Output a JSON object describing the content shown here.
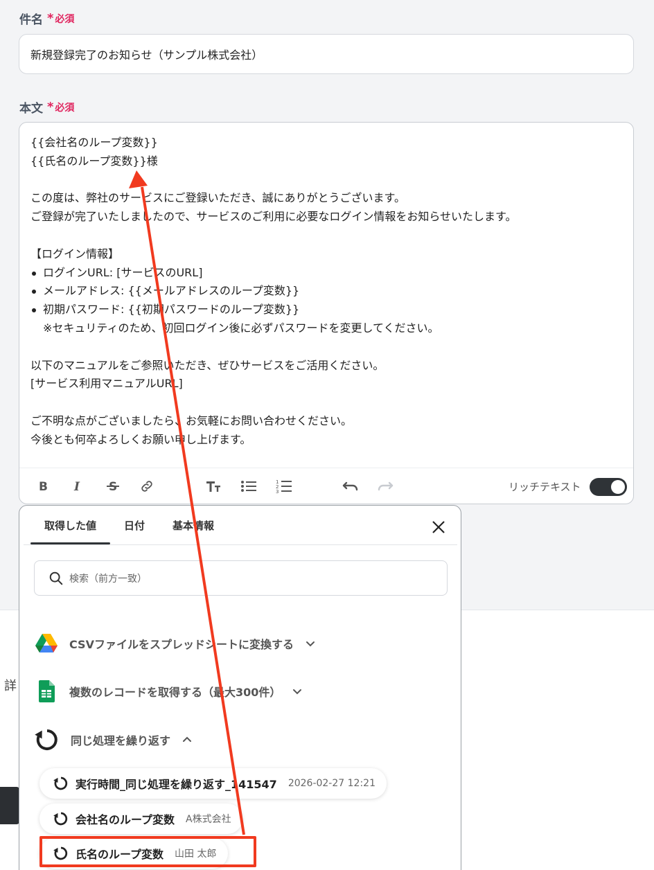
{
  "subject": {
    "label": "件名",
    "required_mark": "*",
    "required_text": "必須",
    "value": "新規登録完了のお知らせ（サンプル株式会社）"
  },
  "body": {
    "label": "本文",
    "required_mark": "*",
    "required_text": "必須",
    "lines": {
      "l1": "{{会社名のループ変数}}",
      "l2": "{{氏名のループ変数}}様",
      "l4": "この度は、弊社のサービスにご登録いただき、誠にありがとうございます。",
      "l5": "ご登録が完了いたしましたので、サービスのご利用に必要なログイン情報をお知らせいたします。",
      "l7": "【ログイン情報】",
      "li1": "ログインURL: [サービスのURL]",
      "li2": "メールアドレス: {{メールアドレスのループ変数}}",
      "li3": "初期パスワード: {{初期パスワードのループ変数}}",
      "note": "※セキュリティのため、初回ログイン後に必ずパスワードを変更してください。",
      "l12": "以下のマニュアルをご参照いただき、ぜひサービスをご活用ください。",
      "l13": "[サービス利用マニュアルURL]",
      "l15": "ご不明な点がございましたら、お気軽にお問い合わせください。",
      "l16": "今後とも何卒よろしくお願い申し上げます。"
    }
  },
  "toolbar": {
    "icons": [
      "bold-icon",
      "italic-icon",
      "strikethrough-icon",
      "link-icon",
      "font-size-icon",
      "bullet-list-icon",
      "numbered-list-icon",
      "undo-icon",
      "redo-icon"
    ],
    "rich_text_label": "リッチテキスト",
    "rich_text_on": true
  },
  "popup": {
    "tabs": [
      "取得した値",
      "日付",
      "基本情報"
    ],
    "active_tab": "取得した値",
    "search_placeholder": "検索（前方一致）",
    "sections": [
      {
        "label": "CSVファイルをスプレッドシートに変換する",
        "icon": "google-drive-icon",
        "expanded": false
      },
      {
        "label": "複数のレコードを取得する（最大300件）",
        "icon": "google-sheets-icon",
        "expanded": false
      },
      {
        "label": "同じ処理を繰り返す",
        "icon": "loop-icon",
        "expanded": true
      }
    ],
    "items": [
      {
        "name": "実行時間_同じ処理を繰り返す_141547",
        "value": "2026-02-27 12:21"
      },
      {
        "name": "会社名のループ変数",
        "value": "A株式会社"
      },
      {
        "name": "氏名のループ変数",
        "value": "山田 太郎"
      }
    ]
  },
  "background": {
    "side_label": "詳"
  },
  "colors": {
    "accent_required": "#e0245e",
    "annotation_red": "#f13a1f",
    "toggle_dark": "#2f3337"
  }
}
